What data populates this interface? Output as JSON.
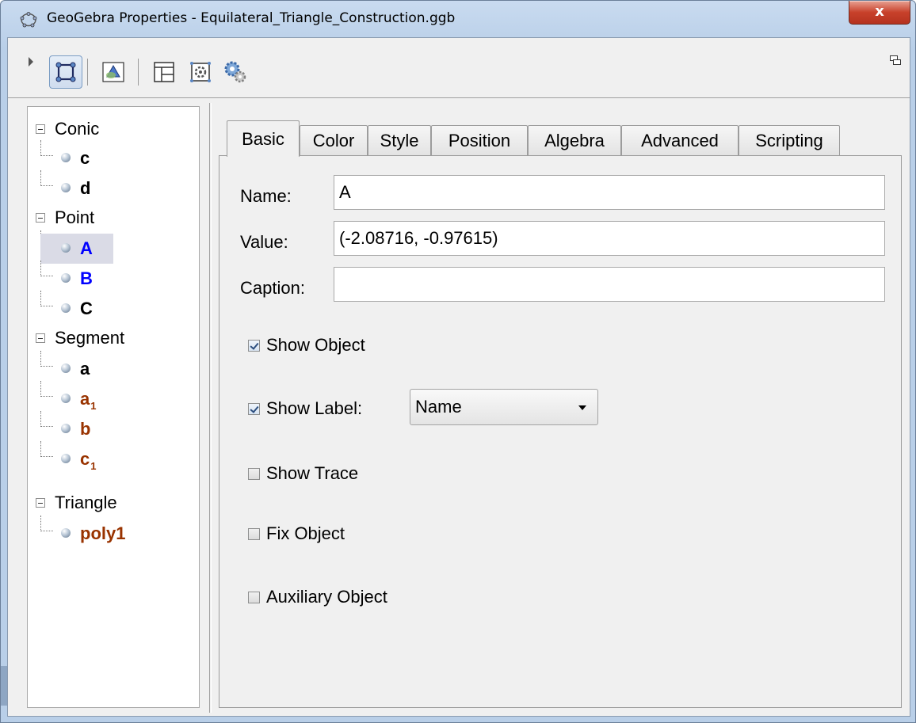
{
  "window": {
    "title": "GeoGebra Properties - Equilateral_Triangle_Construction.ggb",
    "close_label": "x"
  },
  "toolbar": {
    "buttons": [
      {
        "name": "objects-icon",
        "selected": true
      },
      {
        "name": "graphics-icon",
        "selected": false
      },
      {
        "name": "layout-icon",
        "selected": false
      },
      {
        "name": "defaults-icon",
        "selected": false
      },
      {
        "name": "advanced-settings-icon",
        "selected": false
      }
    ]
  },
  "tree": {
    "groups": [
      {
        "label": "Conic",
        "items": [
          {
            "label": "c",
            "sub": "",
            "color": "#000000"
          },
          {
            "label": "d",
            "sub": "",
            "color": "#000000"
          }
        ]
      },
      {
        "label": "Point",
        "items": [
          {
            "label": "A",
            "sub": "",
            "color": "#0000ff",
            "selected": true
          },
          {
            "label": "B",
            "sub": "",
            "color": "#0000ff"
          },
          {
            "label": "C",
            "sub": "",
            "color": "#000000"
          }
        ]
      },
      {
        "label": "Segment",
        "items": [
          {
            "label": "a",
            "sub": "",
            "color": "#000000"
          },
          {
            "label": "a",
            "sub": "1",
            "color": "#993300"
          },
          {
            "label": "b",
            "sub": "",
            "color": "#993300"
          },
          {
            "label": "c",
            "sub": "1",
            "color": "#993300"
          }
        ]
      },
      {
        "label": "Triangle",
        "items": [
          {
            "label": "poly1",
            "sub": "",
            "color": "#993300"
          }
        ]
      }
    ]
  },
  "tabs": [
    "Basic",
    "Color",
    "Style",
    "Position",
    "Algebra",
    "Advanced",
    "Scripting"
  ],
  "active_tab": "Basic",
  "basic": {
    "name_label": "Name:",
    "name_value": "A",
    "value_label": "Value:",
    "value_value": "(-2.08716, -0.97615)",
    "caption_label": "Caption:",
    "caption_value": "",
    "show_object_label": "Show Object",
    "show_object_checked": true,
    "show_label_label": "Show Label:",
    "show_label_checked": true,
    "show_label_option": "Name",
    "show_trace_label": "Show Trace",
    "show_trace_checked": false,
    "fix_object_label": "Fix Object",
    "fix_object_checked": false,
    "auxiliary_object_label": "Auxiliary Object",
    "auxiliary_object_checked": false
  }
}
